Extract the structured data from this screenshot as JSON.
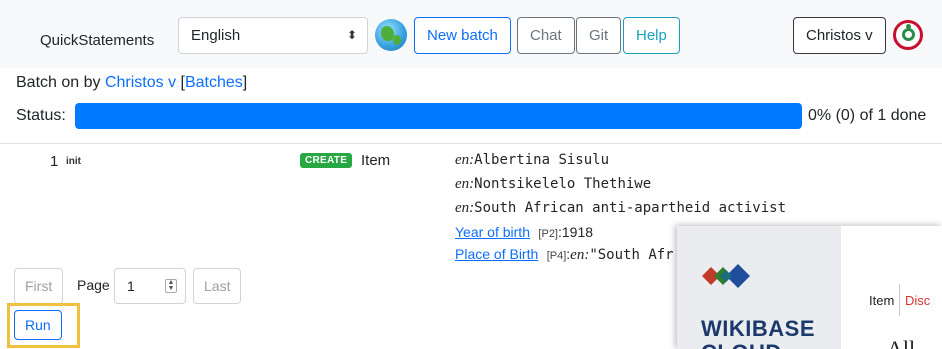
{
  "navbar": {
    "brand": "QuickStatements",
    "language": {
      "selected": "English"
    },
    "buttons": {
      "new_batch": "New batch",
      "chat": "Chat",
      "git": "Git",
      "help": "Help"
    },
    "user": "Christos v"
  },
  "batch": {
    "prefix": "Batch on by ",
    "user_link": "Christos v",
    "open_bracket": " [",
    "batches_link": "Batches",
    "close_bracket": "]"
  },
  "status": {
    "label": "Status:",
    "progress_fraction": 1.0,
    "text": "0% (0) of 1 done"
  },
  "command": {
    "number": "1",
    "state": "init",
    "action_badge": "CREATE",
    "entity_type": "Item",
    "lines": [
      {
        "lang": "en:",
        "text": "Albertina Sisulu"
      },
      {
        "lang": "en:",
        "text": "Nontsikelelo Thethiwe"
      },
      {
        "lang": "en:",
        "text": "South African anti-apartheid activist"
      }
    ],
    "statements": [
      {
        "property": "Year of birth",
        "pid": "[P2]",
        "sep": ":",
        "value": "1918"
      },
      {
        "property": "Place of Birth",
        "pid": "[P4]",
        "sep": ":",
        "lang": "en:",
        "value": "\"South Afr"
      }
    ]
  },
  "pager": {
    "first": "First",
    "page_label": "Page",
    "page_value": "1",
    "last": "Last"
  },
  "run_button": "Run",
  "popup": {
    "wordmark_line1": "WIKIBASE",
    "wordmark_line2": "CLOUD",
    "tab_item": "Item",
    "tab_discussion": "Disc",
    "heading": "All"
  },
  "colors": {
    "primary": "#0d6efd",
    "progress": "#007bff",
    "create_badge": "#28a745",
    "highlight": "#f0c040"
  }
}
